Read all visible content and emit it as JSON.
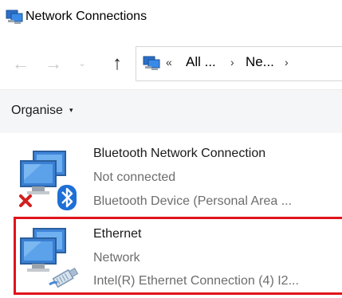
{
  "window": {
    "title": "Network Connections"
  },
  "nav": {
    "back": "←",
    "forward": "→",
    "recent": "⌄",
    "up": "↑"
  },
  "address": {
    "overflow": "«",
    "seg1": "All ...",
    "sep": "›",
    "seg2": "Ne..."
  },
  "toolbar": {
    "organise_label": "Organise",
    "organise_caret": "▾"
  },
  "connections": [
    {
      "name": "Bluetooth Network Connection",
      "status": "Not connected",
      "device": "Bluetooth Device (Personal Area ..."
    },
    {
      "name": "Ethernet",
      "status": "Network",
      "device": "Intel(R) Ethernet Connection (4) I2..."
    }
  ],
  "colors": {
    "highlight": "#e0141c",
    "status_text": "#6d6d6d",
    "disconnected_x": "#d11f1f",
    "bluetooth": "#1f6fd6"
  },
  "icons": [
    "network-connections-icon",
    "back-arrow-icon",
    "forward-arrow-icon",
    "recent-locations-icon",
    "up-arrow-icon",
    "network-folder-icon",
    "bluetooth-connection-icon",
    "ethernet-connection-icon"
  ]
}
